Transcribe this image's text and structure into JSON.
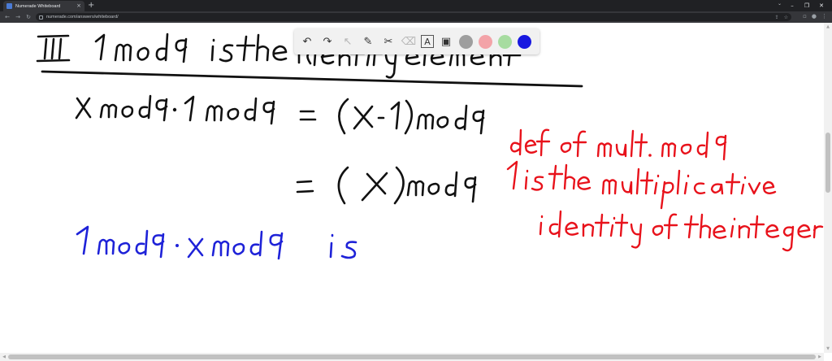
{
  "browser": {
    "tab_title": "Numerade Whiteboard",
    "tab_close": "×",
    "new_tab": "+",
    "url": "numerade.com/answers/whiteboard/",
    "controls": {
      "minimize": "–",
      "restore": "❐",
      "close": "✕"
    },
    "tab_search": "⌄"
  },
  "whiteboard_toolbar": {
    "tools": [
      {
        "name": "undo-button",
        "glyph": "↶",
        "enabled": true
      },
      {
        "name": "redo-button",
        "glyph": "↷",
        "enabled": true
      },
      {
        "name": "select-tool",
        "glyph": "↖",
        "enabled": false
      },
      {
        "name": "pen-tool",
        "glyph": "✎",
        "enabled": true
      },
      {
        "name": "tools-tool",
        "glyph": "✂",
        "enabled": true
      },
      {
        "name": "eraser-tool",
        "glyph": "⌫",
        "enabled": false
      },
      {
        "name": "text-tool",
        "glyph": "A",
        "enabled": true
      },
      {
        "name": "image-tool",
        "glyph": "▣",
        "enabled": true
      }
    ],
    "colors": [
      "#9e9e9e",
      "#f3a3a8",
      "#a7dca0",
      "#1818e0"
    ]
  },
  "colors": {
    "black_ink": "#111111",
    "red_ink": "#e8121b",
    "blue_ink": "#1e22d8"
  }
}
